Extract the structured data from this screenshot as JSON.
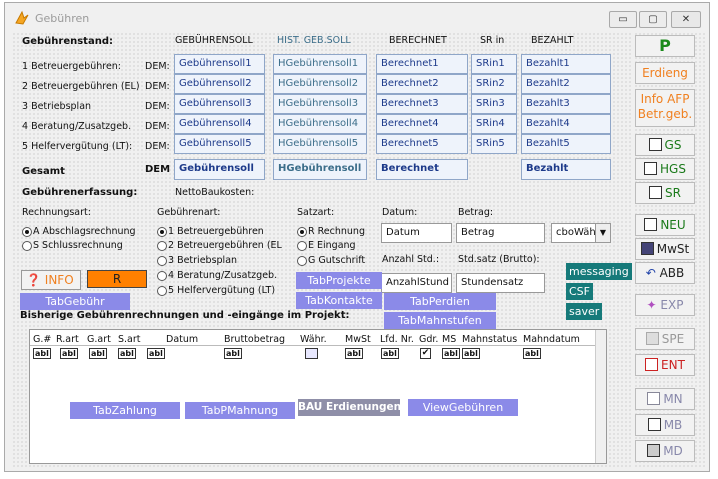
{
  "window": {
    "title": "Gebühren",
    "minimize": "▭",
    "maximize": "▢",
    "close": "✕"
  },
  "headers": {
    "section": "Gebührenstand:",
    "soll": "GEBÜHRENSOLL",
    "hist": "HIST. GEB.SOLL",
    "berechnet": "BERECHNET",
    "srin": "SR in",
    "bezahlt": "BEZAHLT"
  },
  "rows": [
    {
      "label": "1 Betreuergebühren:",
      "cur": "DEM:",
      "soll": "Gebührensoll1",
      "hist": "HGebührensoll1",
      "ber": "Berechnet1",
      "sr": "SRin1",
      "bez": "Bezahlt1"
    },
    {
      "label": "2 Betreuergebühren (EL)",
      "cur": "DEM:",
      "soll": "Gebührensoll2",
      "hist": "HGebührensoll2",
      "ber": "Berechnet2",
      "sr": "SRin2",
      "bez": "Bezahlt2"
    },
    {
      "label": "3 Betriebsplan",
      "cur": "DEM:",
      "soll": "Gebührensoll3",
      "hist": "HGebührensoll3",
      "ber": "Berechnet3",
      "sr": "SRin3",
      "bez": "Bezahlt3"
    },
    {
      "label": "4 Beratung/Zusatzgeb.",
      "cur": "DEM:",
      "soll": "Gebührensoll4",
      "hist": "HGebührensoll4",
      "ber": "Berechnet4",
      "sr": "SRin4",
      "bez": "Bezahlt4"
    },
    {
      "label": "5 Helfervergütung (LT):",
      "cur": "DEM:",
      "soll": "Gebührensoll5",
      "hist": "HGebührensoll5",
      "ber": "Berechnet5",
      "sr": "SRin5",
      "bez": "Bezahlt5"
    }
  ],
  "total": {
    "label": "Gesamt",
    "cur": "DEM",
    "soll": "Gebührensoll",
    "hist": "HGebührensoll",
    "ber": "Berechnet",
    "bez": "Bezahlt"
  },
  "erfassung": {
    "title": "Gebührenerfassung:",
    "netto": "NettoBaukosten:",
    "rechnungsart": "Rechnungsart:",
    "gebuehrenart": "Gebührenart:",
    "satzart": "Satzart:",
    "datum": "Datum:",
    "betrag": "Betrag:",
    "anzahl": "Anzahl Std.:",
    "stdsatz": "Std.satz (Brutto):"
  },
  "rechnungsart_opts": [
    "A Abschlagsrechnung",
    "S Schlussrechnung"
  ],
  "gebuehrenart_opts": [
    "1 Betreuergebühren",
    "2 Betreuergebühren (EL",
    "3 Betriebsplan",
    "4 Beratung/Zusatzgeb.",
    "5 Helfervergütung (LT)"
  ],
  "satzart_opts": [
    "R Rechnung",
    "E Eingang",
    "G Gutschrift"
  ],
  "fields": {
    "datum": "Datum",
    "betrag": "Betrag",
    "cbo": "cboWäh",
    "anzahl": "AnzahlStund",
    "stundensatz": "Stundensatz"
  },
  "buttons": {
    "info": "INFO",
    "r": "R"
  },
  "tabs": {
    "gebuehr": "TabGebühr",
    "projekte": "TabProjekte",
    "kontakte": "TabKontakte",
    "perdien": "TabPerdien",
    "mahnstufen": "TabMahnstufen",
    "zahlung": "TabZahlung",
    "pmahnung": "TabPMahnung",
    "bau": "BAU Erdienungen",
    "view": "ViewGebühren"
  },
  "teal": {
    "messaging": "messaging",
    "csf": "CSF",
    "saver": "saver"
  },
  "bisherige": "Bisherige Gebührenrechnungen und -eingänge im Projekt:",
  "columns": [
    "G.#",
    "R.art",
    "G.art",
    "S.art",
    "Datum",
    "Bruttobetrag",
    "Währ.",
    "MwSt",
    "Lfd. Nr.",
    "Gdr.",
    "MS",
    "Mahnstatus",
    "Mahndatum"
  ],
  "abl": "abl",
  "side": {
    "p": "P",
    "erdieng": "Erdieng",
    "info_afp": "Info AFP Betr.geb.",
    "gs": "GS",
    "hgs": "HGS",
    "sr": "SR",
    "neu": "NEU",
    "mwst": "MwSt",
    "abb": "ABB",
    "exp": "EXP",
    "spe": "SPE",
    "ent": "ENT",
    "mn": "MN",
    "mb": "MB",
    "md": "MD"
  },
  "colors": {
    "tab": "#8b8ae8",
    "teal": "#167a7a",
    "link": "#1d3a8a",
    "orange": "#f08020"
  }
}
